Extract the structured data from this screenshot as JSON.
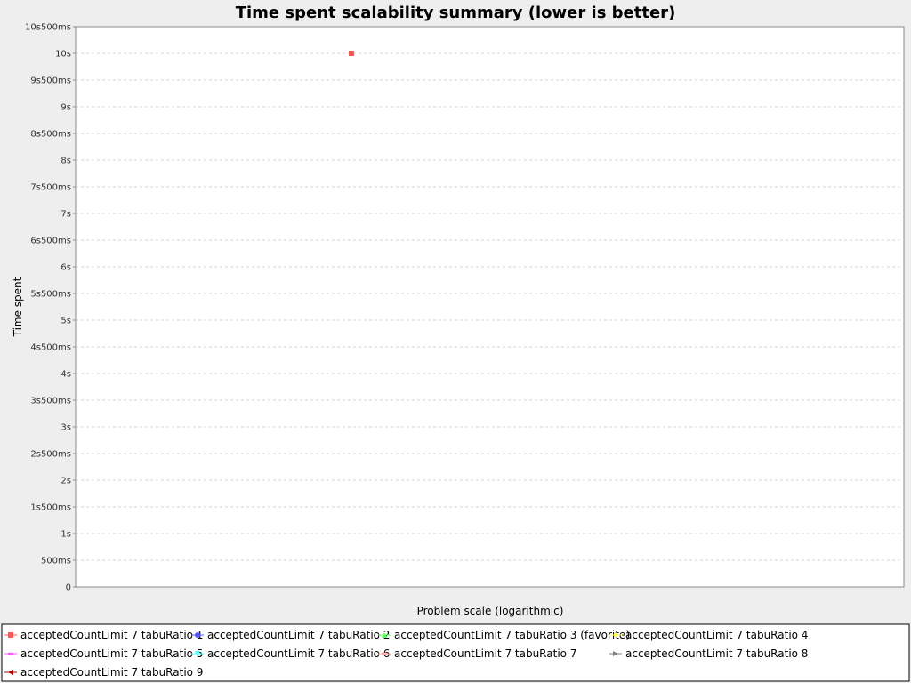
{
  "chart_data": {
    "type": "scatter",
    "title": "Time spent scalability summary (lower is better)",
    "xlabel": "Problem scale (logarithmic)",
    "ylabel": "Time spent",
    "x_scale": "log",
    "ylim_ms": [
      0,
      10500
    ],
    "y_ticks": [
      {
        "value": 0,
        "label": "0"
      },
      {
        "value": 500,
        "label": "500ms"
      },
      {
        "value": 1000,
        "label": "1s"
      },
      {
        "value": 1500,
        "label": "1s500ms"
      },
      {
        "value": 2000,
        "label": "2s"
      },
      {
        "value": 2500,
        "label": "2s500ms"
      },
      {
        "value": 3000,
        "label": "3s"
      },
      {
        "value": 3500,
        "label": "3s500ms"
      },
      {
        "value": 4000,
        "label": "4s"
      },
      {
        "value": 4500,
        "label": "4s500ms"
      },
      {
        "value": 5000,
        "label": "5s"
      },
      {
        "value": 5500,
        "label": "5s500ms"
      },
      {
        "value": 6000,
        "label": "6s"
      },
      {
        "value": 6500,
        "label": "6s500ms"
      },
      {
        "value": 7000,
        "label": "7s"
      },
      {
        "value": 7500,
        "label": "7s500ms"
      },
      {
        "value": 8000,
        "label": "8s"
      },
      {
        "value": 8500,
        "label": "8s500ms"
      },
      {
        "value": 9000,
        "label": "9s"
      },
      {
        "value": 9500,
        "label": "9s500ms"
      },
      {
        "value": 10000,
        "label": "10s"
      },
      {
        "value": 10500,
        "label": "10s500ms"
      }
    ],
    "grid": true,
    "legend_position": "bottom",
    "series": [
      {
        "name": "acceptedCountLimit 7 tabuRatio 1",
        "color": "#ff5555",
        "marker": "square",
        "points_ms": [
          10000
        ]
      },
      {
        "name": "acceptedCountLimit 7 tabuRatio 2",
        "color": "#5555ff",
        "marker": "circle",
        "points_ms": [
          10000
        ]
      },
      {
        "name": "acceptedCountLimit 7 tabuRatio 3 (favorite)",
        "color": "#55ff55",
        "marker": "triangle-up",
        "points_ms": [
          10000
        ]
      },
      {
        "name": "acceptedCountLimit 7 tabuRatio 4",
        "color": "#ffff55",
        "marker": "diamond",
        "points_ms": [
          10000
        ]
      },
      {
        "name": "acceptedCountLimit 7 tabuRatio 5",
        "color": "#ff55ff",
        "marker": "rect-h",
        "points_ms": [
          10000
        ]
      },
      {
        "name": "acceptedCountLimit 7 tabuRatio 6",
        "color": "#55ffff",
        "marker": "triangle-down",
        "points_ms": [
          10000
        ]
      },
      {
        "name": "acceptedCountLimit 7 tabuRatio 7",
        "color": "#ffafaf",
        "marker": "rect-h",
        "points_ms": [
          10000
        ]
      },
      {
        "name": "acceptedCountLimit 7 tabuRatio 8",
        "color": "#808080",
        "marker": "triangle-right",
        "points_ms": [
          10000
        ]
      },
      {
        "name": "acceptedCountLimit 7 tabuRatio 9",
        "color": "#b00000",
        "marker": "triangle-left",
        "points_ms": [
          10000
        ]
      }
    ]
  }
}
